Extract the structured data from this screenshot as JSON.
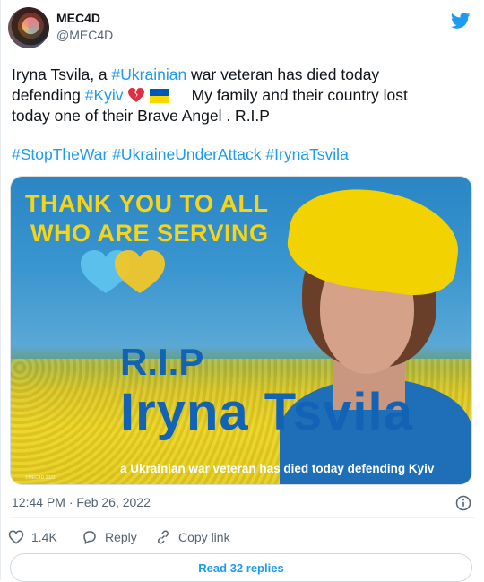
{
  "author": {
    "name": "MEC4D",
    "handle": "@MEC4D"
  },
  "tweet": {
    "line1_pre": "Iryna Tsvila, a ",
    "hashtag_ukrainian": "#Ukrainian",
    "line1_post": " war veteran has died today",
    "line2_pre": "defending ",
    "hashtag_kyiv": "#Kyiv",
    "line2_post": "My family and their country lost",
    "line3": "today one of their Brave Angel . R.I.P",
    "hashtags": [
      "#StopTheWar",
      "#UkraineUnderAttack",
      "#IrynaTsvila"
    ]
  },
  "image": {
    "headline1": "THANK YOU TO ALL",
    "headline2": "WHO ARE SERVING",
    "rip": "R.I.P",
    "name": "Iryna Tsvila",
    "subtitle": "a Ukrainian war veteran has died today defending Kyiv",
    "credit": "©MEC4D 2022"
  },
  "meta": {
    "timestamp": "12:44 PM · Feb 26, 2022"
  },
  "actions": {
    "likes": "1.4K",
    "reply_label": "Reply",
    "copy_label": "Copy link"
  },
  "read_replies_label": "Read 32 replies",
  "colors": {
    "accent": "#1d9bf0",
    "text": "#0f1419",
    "muted": "#536471",
    "flag_blue": "#0057b7",
    "flag_yellow": "#ffd700"
  },
  "icons": [
    "twitter-bird-icon",
    "broken-heart-emoji",
    "ukraine-flag-emoji",
    "info-icon",
    "heart-icon",
    "reply-icon",
    "link-icon"
  ]
}
